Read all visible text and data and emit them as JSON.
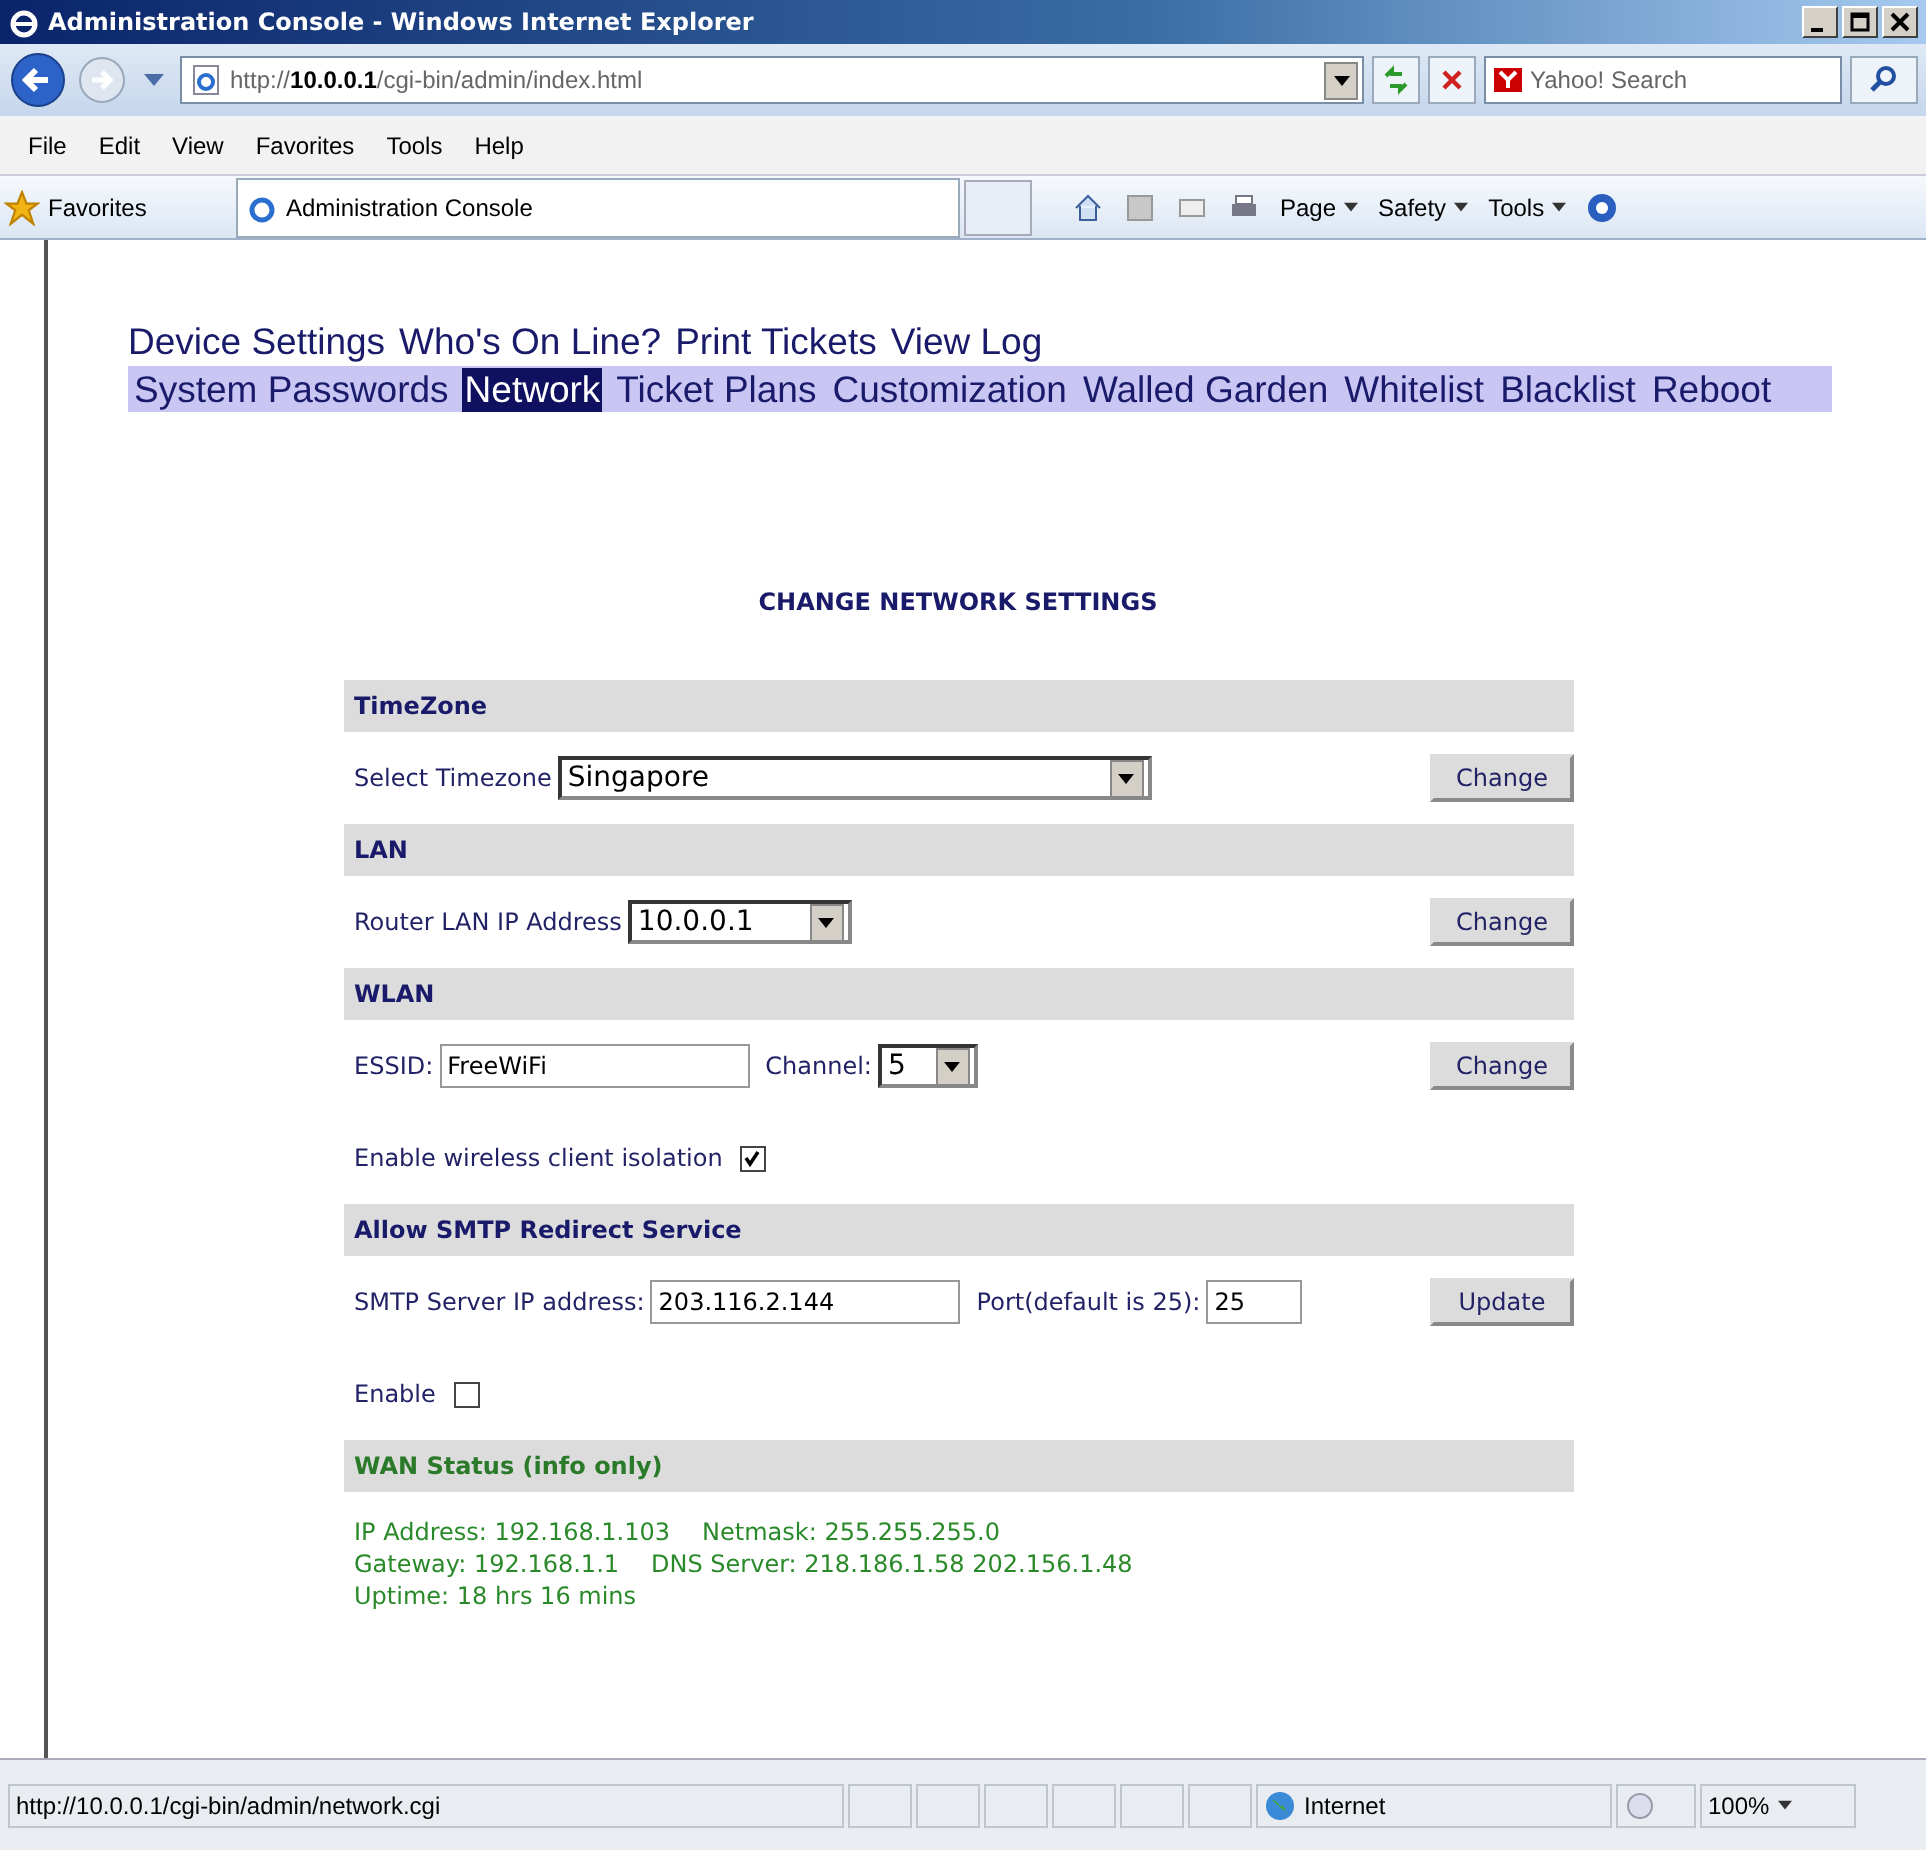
{
  "window": {
    "title": "Administration Console - Windows Internet Explorer"
  },
  "address_bar": {
    "url_prefix": "http://",
    "url_host": "10.0.0.1",
    "url_path": "/cgi-bin/admin/index.html"
  },
  "search": {
    "placeholder": "Yahoo! Search"
  },
  "menu": [
    "File",
    "Edit",
    "View",
    "Favorites",
    "Tools",
    "Help"
  ],
  "favorites_bar": {
    "favorites": "Favorites",
    "tab": "Administration Console",
    "commands": [
      "Page",
      "Safety",
      "Tools"
    ]
  },
  "nav_links": [
    "Device Settings",
    "Who's On Line?",
    "Print Tickets",
    "View Log"
  ],
  "tabs": [
    {
      "label": "System Passwords",
      "selected": false
    },
    {
      "label": "Network",
      "selected": true
    },
    {
      "label": "Ticket Plans",
      "selected": false
    },
    {
      "label": "Customization",
      "selected": false
    },
    {
      "label": "Walled Garden",
      "selected": false
    },
    {
      "label": "Whitelist",
      "selected": false
    },
    {
      "label": "Blacklist",
      "selected": false
    },
    {
      "label": "Reboot",
      "selected": false
    }
  ],
  "heading": "CHANGE NETWORK SETTINGS",
  "sections": [
    {
      "title": "TimeZone",
      "kind": "form",
      "rows": [
        [
          {
            "kind": "label",
            "text": "Select Timezone"
          },
          {
            "kind": "select",
            "value": "Singapore"
          },
          {
            "kind": "button",
            "text": "Change"
          }
        ]
      ]
    },
    {
      "title": "LAN",
      "kind": "form",
      "rows": [
        [
          {
            "kind": "label",
            "text": "Router LAN IP Address"
          },
          {
            "kind": "select",
            "value": "10.0.0.1"
          },
          {
            "kind": "button",
            "text": "Change"
          }
        ]
      ]
    },
    {
      "title": "WLAN",
      "kind": "form",
      "rows": [
        [
          {
            "kind": "label",
            "text": "ESSID:"
          },
          {
            "kind": "input",
            "value": "FreeWiFi"
          },
          {
            "kind": "label",
            "text": "Channel:"
          },
          {
            "kind": "select",
            "value": "5"
          },
          {
            "kind": "button",
            "text": "Change"
          }
        ],
        [
          {
            "kind": "label",
            "text": "Enable wireless client isolation"
          },
          {
            "kind": "checkbox",
            "checked": true
          }
        ]
      ]
    },
    {
      "title": "Allow SMTP Redirect Service",
      "kind": "form",
      "rows": [
        [
          {
            "kind": "label",
            "text": "SMTP Server IP address:"
          },
          {
            "kind": "input",
            "value": "203.116.2.144"
          },
          {
            "kind": "label",
            "text": "Port(default is 25):"
          },
          {
            "kind": "input",
            "value": "25"
          },
          {
            "kind": "button",
            "text": "Update"
          }
        ],
        [
          {
            "kind": "label",
            "text": "Enable"
          },
          {
            "kind": "checkbox",
            "checked": false
          }
        ]
      ]
    },
    {
      "title": "WAN Status (info only)",
      "kind": "info",
      "lines": [
        [
          "IP Address: 192.168.1.103",
          "Netmask: 255.255.255.0"
        ],
        [
          "Gateway: 192.168.1.1",
          "DNS Server: 218.186.1.58 202.156.1.48"
        ],
        [
          "Uptime: 18 hrs 16 mins"
        ]
      ]
    }
  ],
  "status_bar": {
    "url": "http://10.0.0.1/cgi-bin/admin/network.cgi",
    "zone": "Internet",
    "zoom": "100%"
  }
}
